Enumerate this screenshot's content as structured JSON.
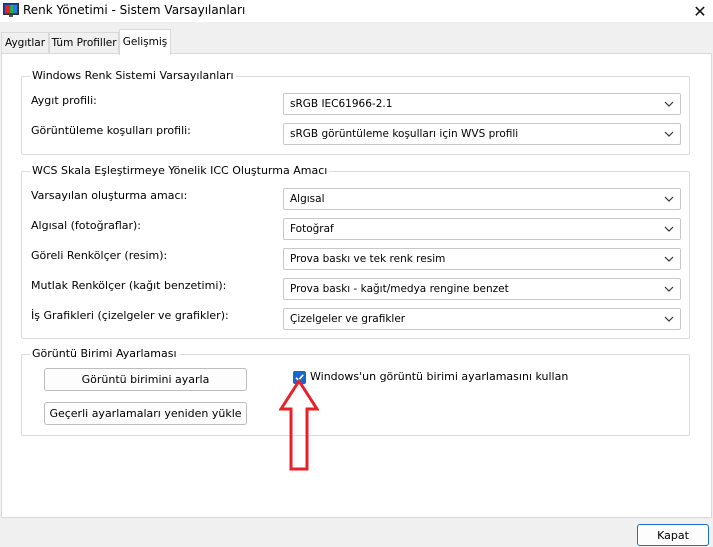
{
  "window": {
    "title": "Renk Yönetimi - Sistem Varsayılanları",
    "close_glyph": "✕"
  },
  "tabs": [
    {
      "label": "Aygıtlar",
      "active": false
    },
    {
      "label": "Tüm Profiller",
      "active": false
    },
    {
      "label": "Gelişmiş",
      "active": true
    }
  ],
  "windows_defaults": {
    "title": "Windows Renk Sistemi Varsayılanları",
    "rows": [
      {
        "label": "Aygıt profili:",
        "value": "sRGB IEC61966-2.1"
      },
      {
        "label": "Görüntüleme koşulları profili:",
        "value": "sRGB görüntüleme koşulları için WVS profili"
      }
    ]
  },
  "wcs": {
    "title": "WCS Skala Eşleştirmeye Yönelik ICC Oluşturma Amacı",
    "rows": [
      {
        "label": "Varsayılan oluşturma amacı:",
        "value": "Algısal"
      },
      {
        "label": "Algısal (fotoğraflar):",
        "value": "Fotoğraf"
      },
      {
        "label": "Göreli Renkölçer (resim):",
        "value": "Prova baskı ve tek renk resim"
      },
      {
        "label": "Mutlak Renkölçer (kağıt benzetimi):",
        "value": "Prova baskı - kağıt/medya rengine benzet"
      },
      {
        "label": "İş Grafikleri (çizelgeler ve grafikler):",
        "value": "Çizelgeler ve grafikler"
      }
    ]
  },
  "calibration": {
    "title": "Görüntü Birimi Ayarlaması",
    "calibrate_button": "Görüntü birimini ayarla",
    "reload_button": "Geçerli ayarlamaları yeniden yükle",
    "checkbox_label": "Windows'un görüntü birimi ayarlamasını kullan",
    "checkbox_checked": true
  },
  "footer": {
    "close_button": "Kapat"
  },
  "colors": {
    "accent": "#1666d0",
    "annotation_arrow": "#e8202a"
  }
}
